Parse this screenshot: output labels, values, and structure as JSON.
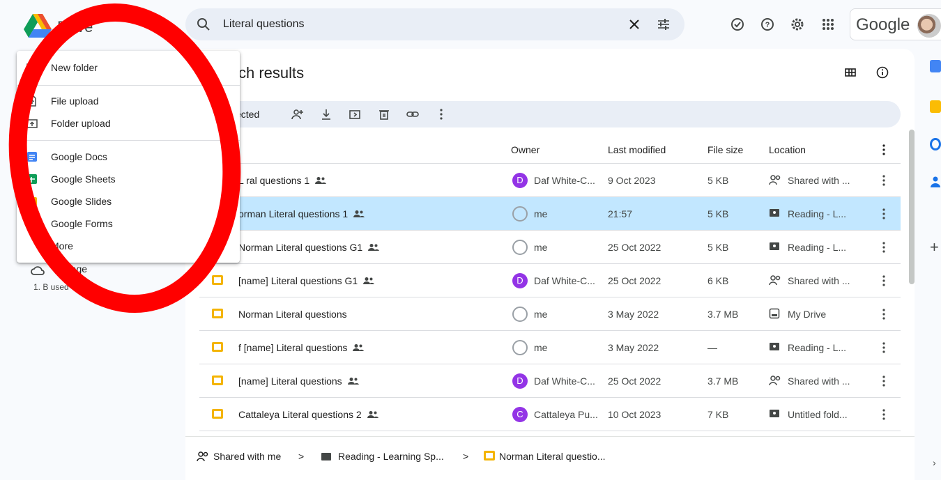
{
  "app": {
    "name": "Drive",
    "account_label": "Google"
  },
  "search": {
    "query": "Literal questions"
  },
  "main": {
    "title": "ch results",
    "selected_label": "ected"
  },
  "columns": {
    "owner": "Owner",
    "modified": "Last modified",
    "size": "File size",
    "location": "Location"
  },
  "rows": [
    {
      "name": "L  ral questions 1",
      "owner_initial": "D",
      "owner": "Daf White-C...",
      "modified": "9 Oct 2023",
      "size": "5 KB",
      "location": "Shared with ...",
      "loc_icon": "shared-icon",
      "owner_color": "#9334e6",
      "selected": false
    },
    {
      "name": "orman  Literal questions 1",
      "owner_initial": "",
      "owner": "me",
      "modified": "21:57",
      "size": "5 KB",
      "location": "Reading - L...",
      "loc_icon": "shared-folder-icon",
      "owner_color": "#bdc1c6",
      "selected": true
    },
    {
      "name": "Norman Literal questions G1",
      "owner_initial": "",
      "owner": "me",
      "modified": "25 Oct 2022",
      "size": "5 KB",
      "location": "Reading - L...",
      "loc_icon": "shared-folder-icon",
      "owner_color": "#bdc1c6",
      "selected": false
    },
    {
      "name": "[name] Literal questions G1",
      "owner_initial": "D",
      "owner": "Daf White-C...",
      "modified": "25 Oct 2022",
      "size": "6 KB",
      "location": "Shared with ...",
      "loc_icon": "shared-icon",
      "owner_color": "#9334e6",
      "selected": false
    },
    {
      "name": "Norman  Literal questions",
      "owner_initial": "",
      "owner": "me",
      "modified": "3 May 2022",
      "size": "3.7 MB",
      "location": "My Drive",
      "loc_icon": "my-drive-icon",
      "owner_color": "#bdc1c6",
      "selected": false
    },
    {
      "name": "f [name] Literal questions",
      "owner_initial": "",
      "owner": "me",
      "modified": "3 May 2022",
      "size": "—",
      "location": "Reading - L...",
      "loc_icon": "shared-folder-icon",
      "owner_color": "#bdc1c6",
      "selected": false
    },
    {
      "name": "[name] Literal questions",
      "owner_initial": "D",
      "owner": "Daf White-C...",
      "modified": "25 Oct 2022",
      "size": "3.7 MB",
      "location": "Shared with ...",
      "loc_icon": "shared-icon",
      "owner_color": "#9334e6",
      "selected": false
    },
    {
      "name": "Cattaleya Literal questions 2",
      "owner_initial": "C",
      "owner": "Cattaleya Pu...",
      "modified": "10 Oct 2023",
      "size": "7 KB",
      "location": "Untitled fold...",
      "loc_icon": "shared-folder-icon",
      "owner_color": "#9334e6",
      "selected": false
    }
  ],
  "breadcrumb": [
    "Shared with me",
    "Reading - Learning Sp...",
    "Norman Literal questio..."
  ],
  "sidebar": {
    "storage": "Storage",
    "used": "1.  B used"
  },
  "menu": {
    "new_folder": "New folder",
    "file_upload": "File upload",
    "folder_upload": "Folder upload",
    "docs": "Google Docs",
    "sheets": "Google Sheets",
    "slides": "Google Slides",
    "forms": "Google Forms",
    "more": "More"
  },
  "colors": {
    "accent": "#0b57d0",
    "selected_row": "#c2e7ff",
    "annotation": "#ff0000"
  }
}
